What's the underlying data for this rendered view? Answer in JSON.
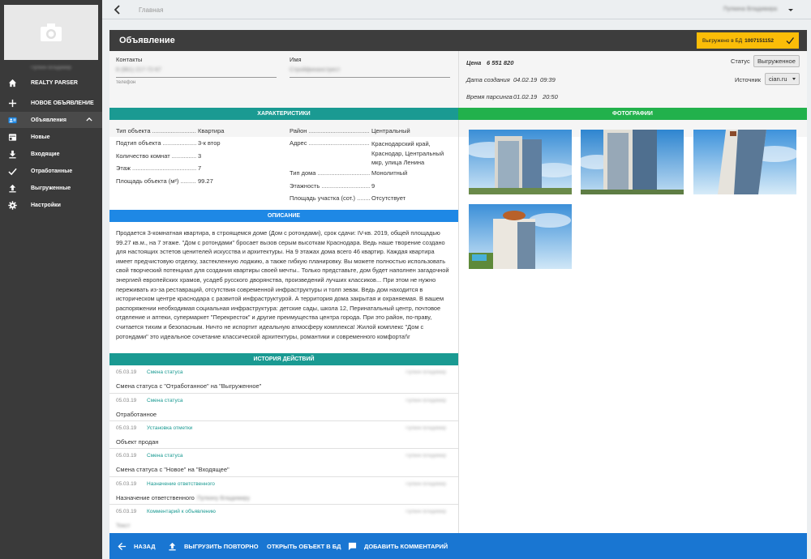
{
  "sidebar": {
    "user_name": "Пупкин Владимир",
    "items": [
      {
        "label": "REALTY PARSER",
        "icon": "home-icon"
      },
      {
        "label": "НОВОЕ ОБЪЯВЛЕНИЕ",
        "icon": "plus-icon"
      },
      {
        "label": "Объявления",
        "icon": "card-icon"
      },
      {
        "label": "Новые",
        "icon": "list-icon"
      },
      {
        "label": "Входящие",
        "icon": "download-icon"
      },
      {
        "label": "Отработанные",
        "icon": "check-icon"
      },
      {
        "label": "Выгруженные",
        "icon": "upload-icon"
      },
      {
        "label": "Настройки",
        "icon": "gear-icon"
      }
    ]
  },
  "topbar": {
    "breadcrumb": "Главная",
    "user": "Пупкина Владимира"
  },
  "card": {
    "title": "Объявление",
    "badge_prefix": "Выгружено в БД",
    "badge_id": "1007151152",
    "badge_color": "#fbbd08"
  },
  "contacts": {
    "label": "Контакты",
    "phone": "8 (961) 217-72-67",
    "phone_label": "телефон",
    "name_label": "Имя",
    "name": "Стройфинанстрест"
  },
  "info": {
    "price_label": "Цена",
    "price": "6 551 820",
    "created_label": "Дата создания",
    "created_date": "04.02.19",
    "created_time": "09:39",
    "parsed_label": "Время парсинга",
    "parsed_date": "01.02.19",
    "parsed_time": "20:50",
    "status_label": "Статус",
    "status": "Выгруженное",
    "source_label": "Источник",
    "source": "cian.ru"
  },
  "sections": {
    "characteristics": "ХАРАКТЕРИСТИКИ",
    "photos": "ФОТОГРАФИИ",
    "description": "ОПИСАНИЕ",
    "history": "ИСТОРИЯ ДЕЙСТВИЙ"
  },
  "characteristics_left": [
    {
      "key": "Тип объекта",
      "value": "Квартира"
    },
    {
      "key": "Подтип объекта",
      "value": "3-к втор"
    },
    {
      "key": "Количество комнат",
      "value": "3"
    },
    {
      "key": "Этаж",
      "value": "7"
    },
    {
      "key": "Площадь объекта (м²)",
      "value": "99.27"
    }
  ],
  "characteristics_right": [
    {
      "key": "Район",
      "value": "Центральный"
    },
    {
      "key": "Адрес",
      "value": "Краснодарский край, Краснодар, Центральный мкр, улица Ленина"
    },
    {
      "key": "Тип дома",
      "value": "Монолитный"
    },
    {
      "key": "Этажность",
      "value": "9"
    },
    {
      "key": "Площадь участка (сот.)",
      "value": "Отсутствует"
    }
  ],
  "description": "Продается 3-комнатная квартира, в строящемся доме (Дом с ротондами), срок сдачи: IV-кв. 2019, общей площадью 99.27 кв.м., на 7 этаже. \"Дом с ротондами\" бросает вызов серым высоткам Краснодара. Ведь наше творение создано для настоящих эстетов ценителей искусства и архитектуры. На 9 этажах дома всего 46 квартир. Каждая квартира имеет предчистовую отделку, застекленную лоджию, а также гибкую планировку. Вы можете полностью использовать свой творческий потенциал для создания квартиры своей мечты.. Только представьте, дом будет наполнен загадочной энергией европейских храмов, усадеб русского дворянства, произведений лучших классиков... При этом не нужно переживать из-за реставраций, отсутствия современной инфраструктуры и толп зевак. Ведь дом находится в историческом центре краснодара с развитой инфраструктурой. А территория дома закрытая и охраняемая. В вашем распоряжении необходимая социальная инфраструктура: детские сады, школа 12, Перинатальный центр, почтовое отделение и аптеки, супермаркет \"Перекресток\" и другие преимущества центра города. При это район, по-праву, считается тихим и безопасным. Ничто не испортит идеальную атмосферу комплекса! Жилой комплекс \"Дом с ротондами\" это идеальное сочетание классической архитектуры, романтики и современного комфорта!\\r",
  "history": [
    {
      "date": "05.03.19",
      "type": "Смена статуса",
      "author": "Пупкин Владимир",
      "text": "Смена статуса с \"Отработанное\" на \"Выгруженное\"",
      "extra": ""
    },
    {
      "date": "05.03.19",
      "type": "Смена статуса",
      "author": "Пупкин Владимир",
      "text": "Отработанное",
      "extra": ""
    },
    {
      "date": "05.03.19",
      "type": "Установка отметки",
      "author": "Пупкин Владимир",
      "text": "Объект продан",
      "extra": ""
    },
    {
      "date": "05.03.19",
      "type": "Смена статуса",
      "author": "Пупкин Владимир",
      "text": "Смена статуса с \"Новое\" на \"Входящее\"",
      "extra": ""
    },
    {
      "date": "05.03.19",
      "type": "Назначение ответственного",
      "author": "Пупкин Владимир",
      "text": "Назначение ответственного",
      "extra": "Пупкину Владимиру"
    },
    {
      "date": "05.03.19",
      "type": "Комментарий к объявлению",
      "author": "Пупкин Владимир",
      "text": "",
      "extra": "Текст"
    }
  ],
  "photos": [
    {
      "icon": "building-photo-1"
    },
    {
      "icon": "building-photo-2"
    },
    {
      "icon": "building-photo-3"
    },
    {
      "icon": "building-photo-4"
    }
  ],
  "actions": {
    "back": "НАЗАД",
    "reupload": "ВЫГРУЗИТЬ ПОВТОРНО",
    "open_db": "ОТКРЫТЬ ОБЪЕКТ В БД",
    "add_comment": "ДОБАВИТЬ КОММЕНТАРИЙ"
  }
}
